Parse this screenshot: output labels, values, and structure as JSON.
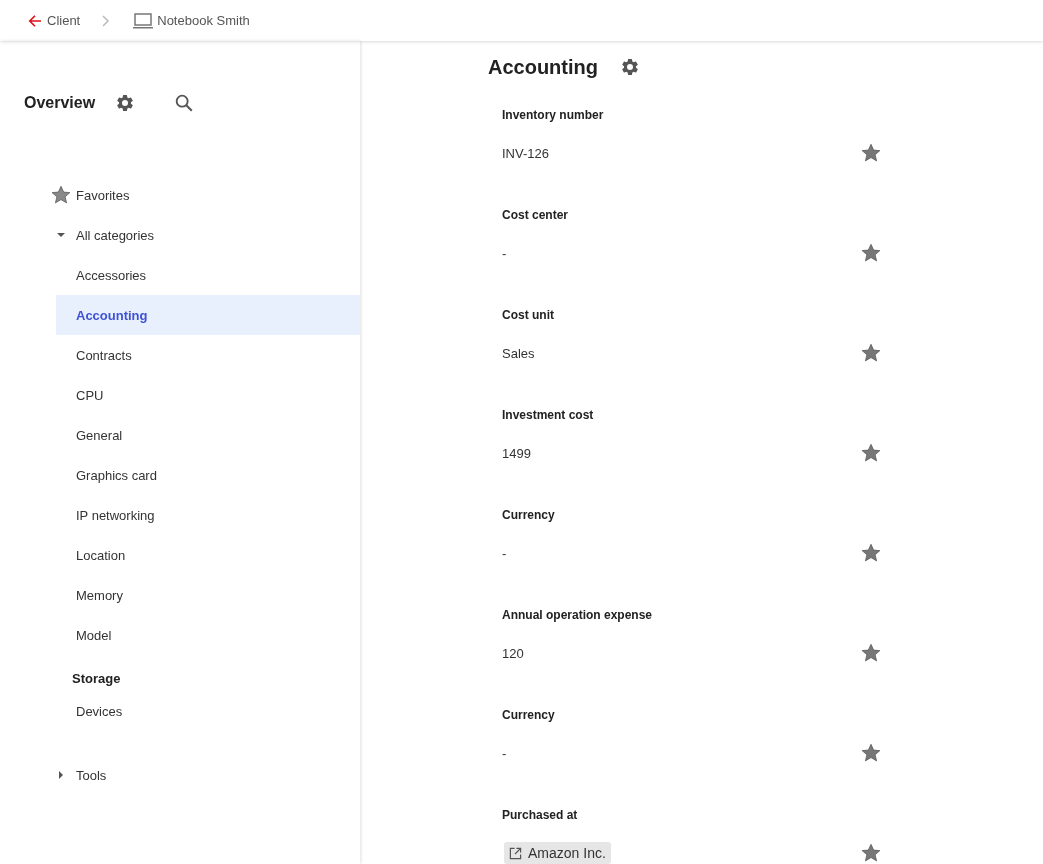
{
  "breadcrumb": {
    "back": "Client",
    "current": "Notebook Smith"
  },
  "sidebar": {
    "title": "Overview",
    "favorites": "Favorites",
    "tree": [
      {
        "label": "All categories",
        "expanded": true,
        "children": [
          {
            "label": "Accessories",
            "selected": false
          },
          {
            "label": "Accounting",
            "selected": true
          },
          {
            "label": "Contracts",
            "selected": false
          },
          {
            "label": "CPU",
            "selected": false
          },
          {
            "label": "General",
            "selected": false
          },
          {
            "label": "Graphics card",
            "selected": false
          },
          {
            "label": "IP networking",
            "selected": false
          },
          {
            "label": "Location",
            "selected": false
          },
          {
            "label": "Memory",
            "selected": false
          },
          {
            "label": "Model",
            "selected": false
          }
        ]
      }
    ],
    "sections": [
      {
        "heading": "Storage",
        "items": [
          {
            "label": "Devices",
            "selected": false
          }
        ]
      }
    ],
    "tools": {
      "label": "Tools",
      "expanded": false
    }
  },
  "main": {
    "title": "Accounting",
    "fields": [
      {
        "label": "Inventory number",
        "value": "INV-126",
        "kind": "text"
      },
      {
        "label": "Cost center",
        "value": "-",
        "kind": "text"
      },
      {
        "label": "Cost unit",
        "value": "Sales",
        "kind": "text"
      },
      {
        "label": "Investment cost",
        "value": "1499",
        "kind": "text"
      },
      {
        "label": "Currency",
        "value": "-",
        "kind": "text"
      },
      {
        "label": "Annual operation expense",
        "value": "120",
        "kind": "text"
      },
      {
        "label": "Currency",
        "value": "-",
        "kind": "text"
      },
      {
        "label": "Purchased at",
        "value": "Amazon Inc.",
        "kind": "link"
      }
    ]
  }
}
